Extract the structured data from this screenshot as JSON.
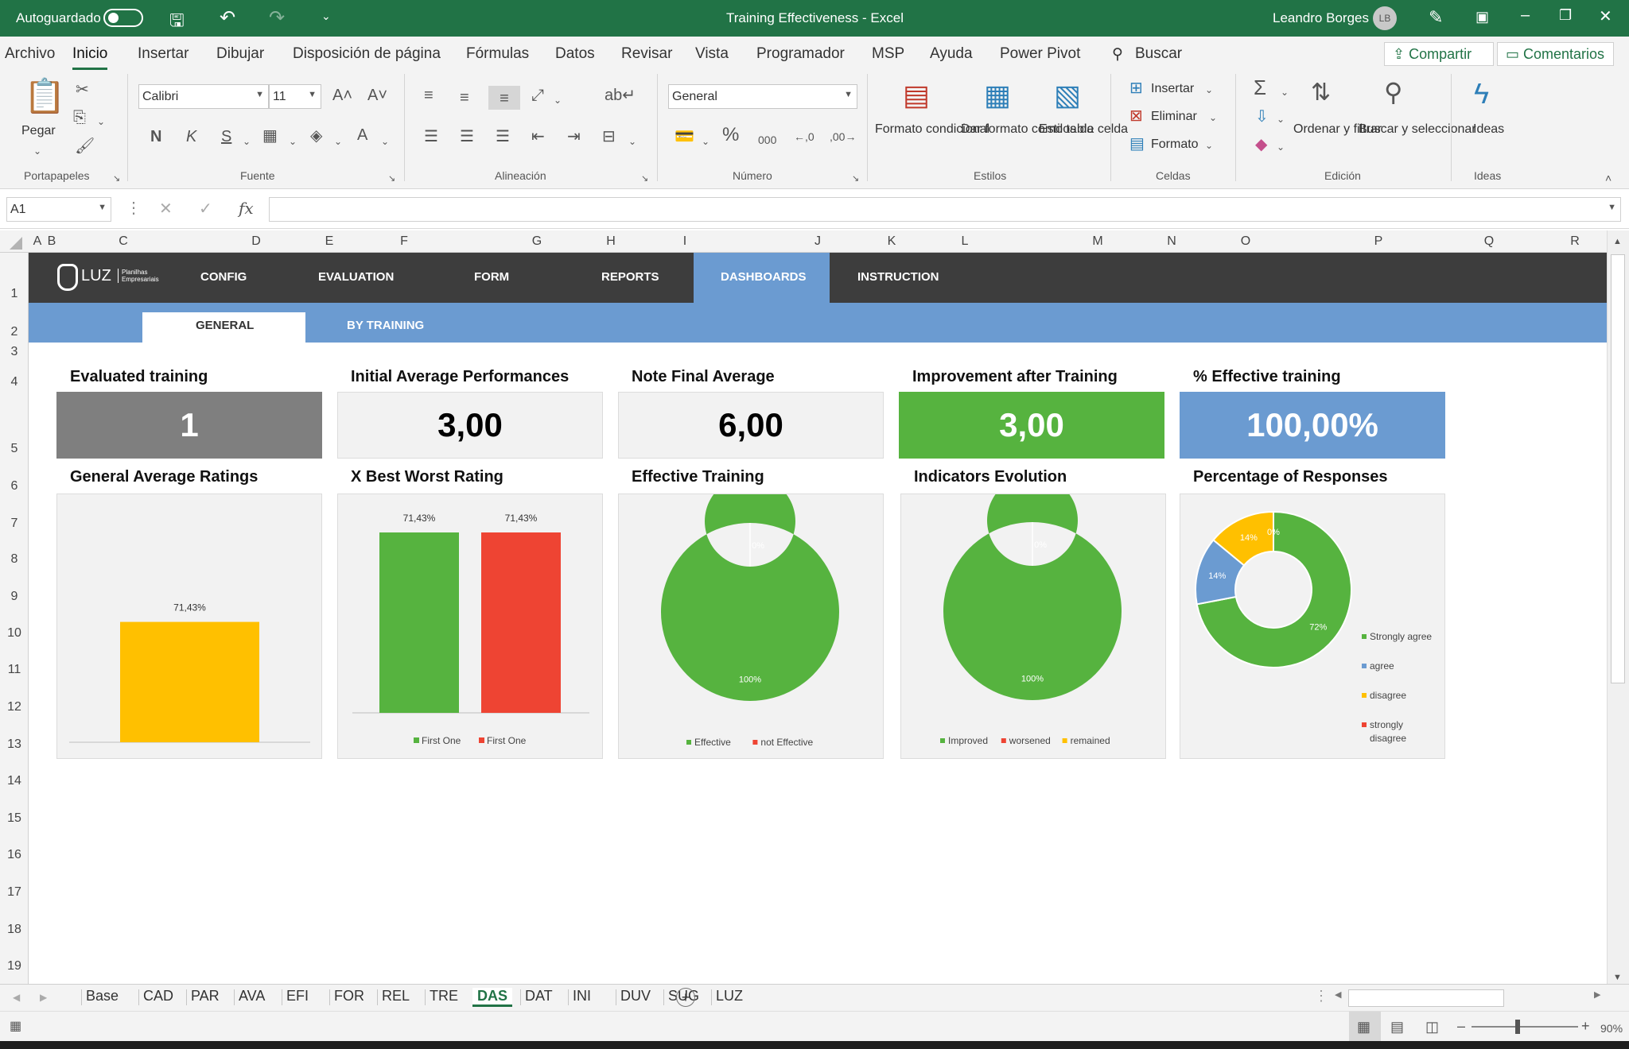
{
  "titlebar": {
    "autosave_label": "Autoguardado",
    "doc_title": "Training Effectiveness  -  Excel",
    "user_name": "Leandro Borges",
    "user_initials": "LB"
  },
  "menu": {
    "items": [
      "Archivo",
      "Inicio",
      "Insertar",
      "Dibujar",
      "Disposición de página",
      "Fórmulas",
      "Datos",
      "Revisar",
      "Vista",
      "Programador",
      "MSP",
      "Ayuda",
      "Power Pivot"
    ],
    "search": "Buscar",
    "share": "Compartir",
    "comments": "Comentarios"
  },
  "ribbon": {
    "paste": "Pegar",
    "font_name": "Calibri",
    "font_size": "11",
    "bold": "N",
    "italic": "K",
    "underline": "S",
    "number_format": "General",
    "cond_format": "Formato condicional",
    "format_table": "Dar formato como tabla",
    "cell_styles": "Estilos de celda",
    "insert": "Insertar",
    "delete": "Eliminar",
    "format": "Formato",
    "sort_filter": "Ordenar y filtrar",
    "find_select": "Buscar y seleccionar",
    "ideas": "Ideas",
    "groups": [
      "Portapapeles",
      "Fuente",
      "Alineación",
      "Número",
      "Estilos",
      "Celdas",
      "Edición",
      "Ideas"
    ]
  },
  "formula_bar": {
    "name_box": "A1",
    "fx": "fx",
    "value": ""
  },
  "columns": [
    "A",
    "B",
    "C",
    "D",
    "E",
    "F",
    "G",
    "H",
    "I",
    "J",
    "K",
    "L",
    "M",
    "N",
    "O",
    "P",
    "Q",
    "R"
  ],
  "rows": [
    "1",
    "2",
    "3",
    "4",
    "5",
    "6",
    "7",
    "8",
    "9",
    "10",
    "11",
    "12",
    "13",
    "14",
    "15",
    "16",
    "17",
    "18",
    "19"
  ],
  "dashboard": {
    "logo": "LUZ",
    "logo_sub": "Planilhas Empresariais",
    "nav": [
      "CONFIG",
      "EVALUATION",
      "FORM",
      "REPORTS",
      "DASHBOARDS",
      "INSTRUCTION"
    ],
    "active_nav": "DASHBOARDS",
    "subnav": [
      "GENERAL",
      "BY TRAINING"
    ],
    "kpis": [
      {
        "title": "Evaluated training",
        "value": "1",
        "bg": "#7f7f7f",
        "fg": "#ffffff"
      },
      {
        "title": "Initial Average Performances",
        "value": "3,00",
        "bg": "#f2f2f2",
        "fg": "#000000"
      },
      {
        "title": "Note Final Average",
        "value": "6,00",
        "bg": "#f2f2f2",
        "fg": "#000000"
      },
      {
        "title": "Improvement after Training",
        "value": "3,00",
        "bg": "#56b33f",
        "fg": "#ffffff"
      },
      {
        "title": "% Effective training",
        "value": "100,00%",
        "bg": "#6b9bd1",
        "fg": "#ffffff"
      }
    ],
    "chart_titles": [
      "General Average Ratings",
      "X Best Worst Rating",
      "Effective Training",
      "Indicators Evolution",
      "Percentage of Responses"
    ]
  },
  "chart_data": [
    {
      "type": "bar",
      "categories": [
        ""
      ],
      "values": [
        71.43
      ],
      "labels": [
        "71,43%"
      ],
      "colors": [
        "#ffc000"
      ],
      "ylim": [
        0,
        100
      ]
    },
    {
      "type": "bar",
      "categories": [
        "First One",
        "First One"
      ],
      "values": [
        71.43,
        71.43
      ],
      "labels": [
        "71,43%",
        "71,43%"
      ],
      "colors": [
        "#56b33f",
        "#ee4433"
      ],
      "legend": [
        "First One",
        "First One"
      ],
      "ylim": [
        0,
        71.43
      ]
    },
    {
      "type": "pie",
      "donut": true,
      "labels": [
        "Effective",
        "not Effective"
      ],
      "values": [
        100,
        0
      ],
      "display": [
        "100%",
        "0%"
      ],
      "colors": [
        "#56b33f",
        "#ee4433"
      ]
    },
    {
      "type": "pie",
      "donut": true,
      "labels": [
        "Improved",
        "worsened",
        "remained"
      ],
      "values": [
        100,
        0,
        0
      ],
      "display": [
        "100%",
        "0%",
        ""
      ],
      "colors": [
        "#56b33f",
        "#ee4433",
        "#ffc000"
      ]
    },
    {
      "type": "pie",
      "donut": true,
      "labels": [
        "Strongly agree",
        "agree",
        "disagree",
        "strongly disagree"
      ],
      "values": [
        72,
        14,
        14,
        0
      ],
      "display": [
        "72%",
        "14%",
        "14%",
        "0%"
      ],
      "colors": [
        "#56b33f",
        "#6b9bd1",
        "#ffc000",
        "#ee4433"
      ]
    }
  ],
  "sheets": [
    "Base",
    "CAD",
    "PAR",
    "AVA",
    "EFI",
    "FOR",
    "REL",
    "TRE",
    "DAS",
    "DAT",
    "INI",
    "DUV",
    "SUG",
    "LUZ"
  ],
  "active_sheet": "DAS",
  "status": {
    "zoom": "90%"
  }
}
